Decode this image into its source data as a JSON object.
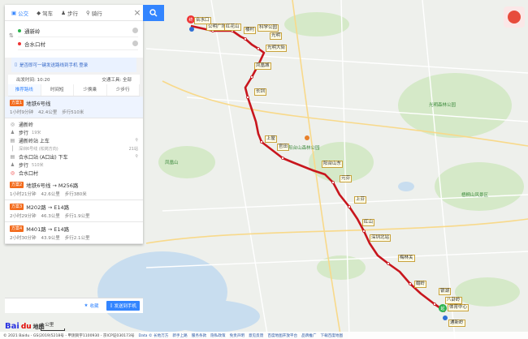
{
  "modes": [
    {
      "label": "公交",
      "icon": "bus-icon",
      "active": true
    },
    {
      "label": "驾车",
      "icon": "car-icon",
      "active": false
    },
    {
      "label": "步行",
      "icon": "walk-icon",
      "active": false
    },
    {
      "label": "骑行",
      "icon": "bike-icon",
      "active": false
    }
  ],
  "route": {
    "from": "通新岭",
    "to": "合水口村"
  },
  "promo": "是否即可一键发送路线到手机 登录",
  "options": {
    "depart": "出发时间: 10:20",
    "transit": "交通工具: 全部"
  },
  "tabs": [
    "推荐路线",
    "时间短",
    "少换乘",
    "少步行"
  ],
  "plans": [
    {
      "badge": "方案1",
      "line": "地铁6号线",
      "time": "1小时9分钟",
      "dist": "42.4公里",
      "walk": "步行510米"
    },
    {
      "badge": "方案2",
      "line": "地铁6号线 → M256路",
      "time": "1小时21分钟",
      "dist": "42.6公里",
      "walk": "步行380米"
    },
    {
      "badge": "方案3",
      "line": "M202路 → E14路",
      "time": "2小时29分钟",
      "dist": "46.3公里",
      "walk": "步行1.9公里"
    },
    {
      "badge": "方案4",
      "line": "M401路 → E14路",
      "time": "2小时30分钟",
      "dist": "43.9公里",
      "walk": "步行2.1公里"
    }
  ],
  "steps": [
    {
      "icon": "start-icon",
      "text": "通新岭",
      "sub": "",
      "right": ""
    },
    {
      "icon": "walk-icon",
      "text": "步行",
      "sub": "19米",
      "right": ""
    },
    {
      "icon": "subway-icon",
      "text": "通新岭站 上车",
      "sub": "",
      "right": ""
    },
    {
      "icon": "line-icon",
      "text": "深圳6号线 (松岗方向)",
      "sub": "",
      "right": "21站"
    },
    {
      "icon": "subway-icon",
      "text": "合水口站 (A口出) 下车",
      "sub": "",
      "right": ""
    },
    {
      "icon": "walk-icon",
      "text": "步行",
      "sub": "510米",
      "right": ""
    },
    {
      "icon": "end-icon",
      "text": "合水口村",
      "sub": "",
      "right": ""
    }
  ],
  "bottom": {
    "fav": "收藏",
    "send": "发送到手机"
  },
  "map": {
    "stations": [
      "合水口",
      "公明广场",
      "红花山",
      "楼村",
      "科学公园",
      "光明",
      "光明大街",
      "凤凰城",
      "长圳",
      "上屋",
      "官田",
      "阳台山东",
      "元芬",
      "上芬",
      "红山",
      "深圳北站",
      "梅林关",
      "翰岭",
      "银湖",
      "八卦岭",
      "体育中心",
      "通新岭"
    ],
    "places": [
      "凤凰山",
      "阳台山森林公园",
      "光明森林公园",
      "梧桐山风景区"
    ],
    "scale": "2 公里"
  },
  "logo": {
    "a": "Bai",
    "b": "地图"
  },
  "footer": {
    "copy": "© 2021 Baidu - GS(2019)5218号 - 甲测资字1100930 - 京ICP证030173号",
    "links": [
      "Data © 长地万方",
      "新手上路",
      "服务条款",
      "隐私政策",
      "免责声明",
      "意见反馈",
      "百度地图开放平台",
      "品牌推广",
      "下载百度地图"
    ]
  },
  "colors": {
    "route": "#c8161d",
    "accent": "#3385ff"
  }
}
